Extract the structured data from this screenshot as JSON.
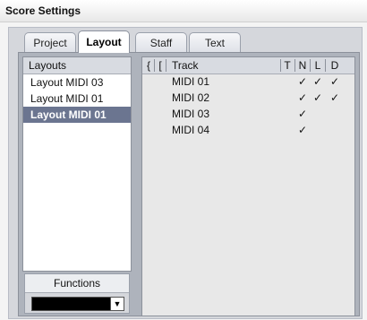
{
  "window": {
    "title": "Score Settings"
  },
  "tabs": [
    {
      "label": "Project",
      "active": false
    },
    {
      "label": "Layout",
      "active": true
    },
    {
      "label": "Staff",
      "active": false
    },
    {
      "label": "Text",
      "active": false
    }
  ],
  "layouts": {
    "header": "Layouts",
    "items": [
      {
        "label": "Layout MIDI 03",
        "selected": false
      },
      {
        "label": "Layout MIDI 01",
        "selected": false
      },
      {
        "label": "Layout MIDI 01",
        "selected": true
      }
    ]
  },
  "tracks": {
    "columns": {
      "brace": "{",
      "bracket": "[",
      "track": "Track",
      "t": "T",
      "n": "N",
      "l": "L",
      "d": "D"
    },
    "rows": [
      {
        "name": "MIDI 01",
        "t": "",
        "n": "✓",
        "l": "✓",
        "d": "✓"
      },
      {
        "name": "MIDI 02",
        "t": "",
        "n": "✓",
        "l": "✓",
        "d": "✓"
      },
      {
        "name": "MIDI 03",
        "t": "",
        "n": "✓",
        "l": "",
        "d": ""
      },
      {
        "name": "MIDI 04",
        "t": "",
        "n": "✓",
        "l": "",
        "d": ""
      }
    ]
  },
  "functions": {
    "label": "Functions",
    "selected_value": ""
  },
  "icons": {
    "dropdown": "chevron-down-icon"
  }
}
